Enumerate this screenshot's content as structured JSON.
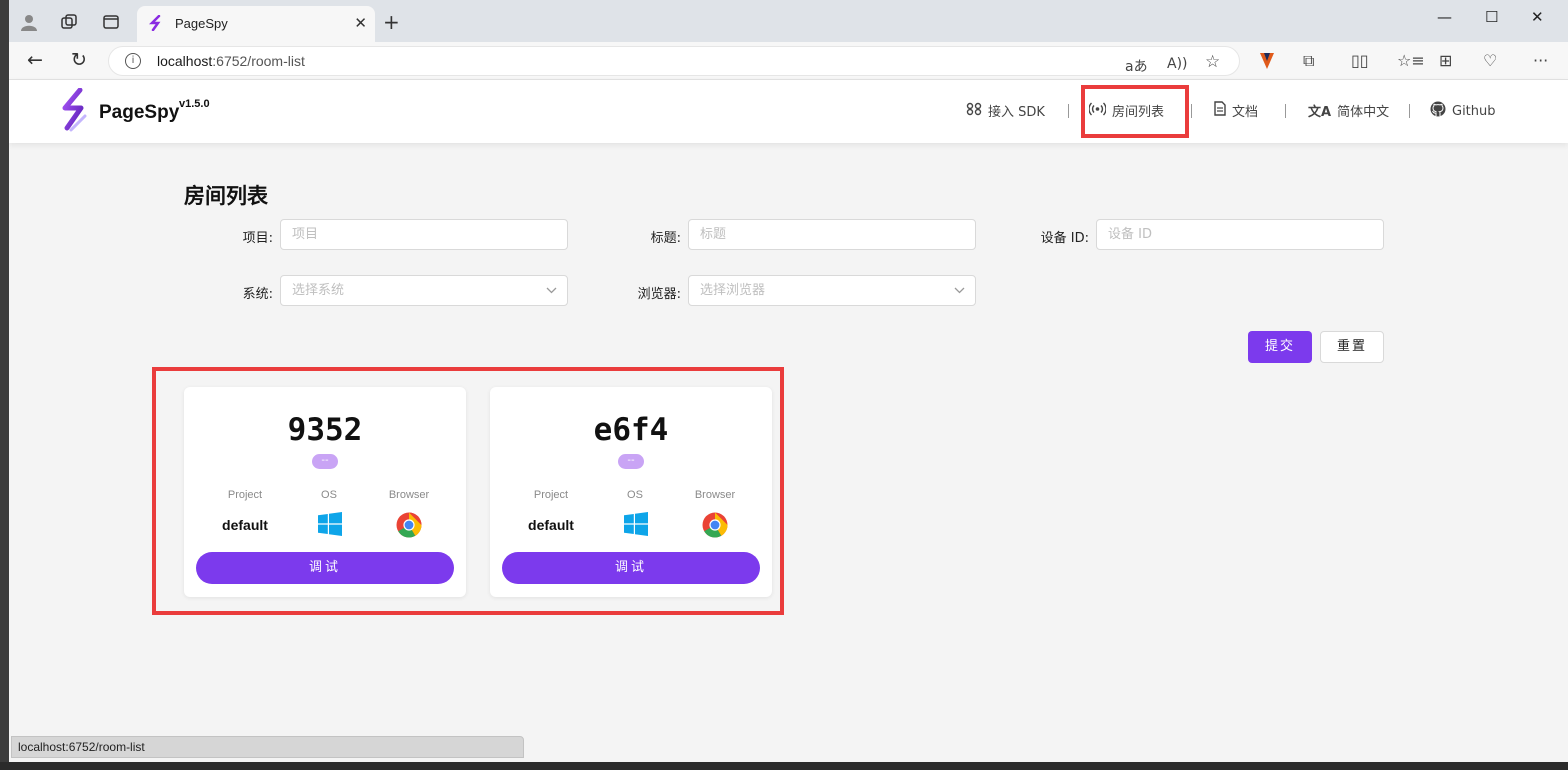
{
  "browser": {
    "tab_title": "PageSpy",
    "url_host": "localhost",
    "url_rest": ":6752/room-list",
    "status_url": "localhost:6752/room-list"
  },
  "header": {
    "brand": "PageSpy",
    "version": "v1.5.0",
    "nav": [
      {
        "label": "接入 SDK",
        "icon": "sdk-icon"
      },
      {
        "label": "房间列表",
        "icon": "broadcast-icon"
      },
      {
        "label": "文档",
        "icon": "document-icon"
      },
      {
        "label": "简体中文",
        "icon": "translate-icon"
      },
      {
        "label": "Github",
        "icon": "github-icon"
      }
    ]
  },
  "main": {
    "title": "房间列表",
    "filters": {
      "project_label": "项目:",
      "project_placeholder": "项目",
      "title_label": "标题:",
      "title_placeholder": "标题",
      "device_label": "设备 ID:",
      "device_placeholder": "设备 ID",
      "os_label": "系统:",
      "os_placeholder": "选择系统",
      "browser_label": "浏览器:",
      "browser_placeholder": "选择浏览器"
    },
    "submit_label": "提交",
    "reset_label": "重置",
    "cards": [
      {
        "id": "9352",
        "tag": "--",
        "project_h": "Project",
        "os_h": "OS",
        "browser_h": "Browser",
        "project": "default",
        "os_icon": "windows-icon",
        "browser_icon": "chrome-icon",
        "button": "调试"
      },
      {
        "id": "e6f4",
        "tag": "--",
        "project_h": "Project",
        "os_h": "OS",
        "browser_h": "Browser",
        "project": "default",
        "os_icon": "windows-icon",
        "browser_icon": "chrome-icon",
        "button": "调试"
      }
    ]
  },
  "colors": {
    "accent": "#7c3aed",
    "highlight": "#ea3c3c"
  }
}
